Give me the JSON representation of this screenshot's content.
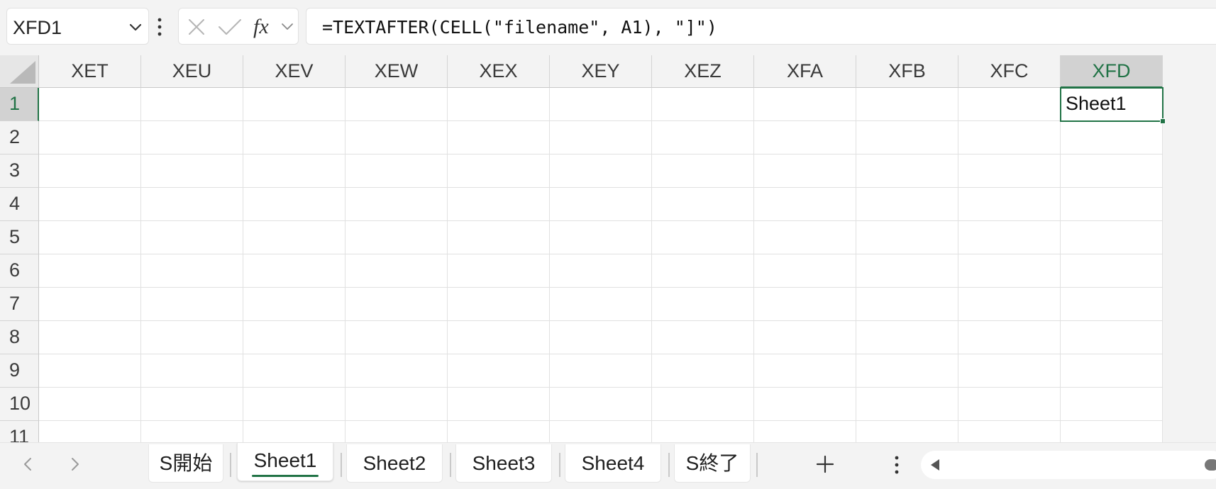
{
  "formula_bar": {
    "name_box_value": "XFD1",
    "formula_text": "=TEXTAFTER(CELL(\"filename\", A1), \"]\")",
    "icons": [
      "chevron-down-icon",
      "more-vertical-icon",
      "cancel-x-icon",
      "confirm-check-icon",
      "function-fx-icon"
    ]
  },
  "grid": {
    "columns": [
      "XET",
      "XEU",
      "XEV",
      "XEW",
      "XEX",
      "XEY",
      "XEZ",
      "XFA",
      "XFB",
      "XFC",
      "XFD"
    ],
    "rows": [
      "1",
      "2",
      "3",
      "4",
      "5",
      "6",
      "7",
      "8",
      "9",
      "10",
      "11"
    ],
    "selected_column": "XFD",
    "selected_row": "1",
    "active_cell": {
      "address": "XFD1",
      "value": "Sheet1"
    }
  },
  "sheet_tabs": {
    "tabs": [
      {
        "label": "S開始",
        "active": false
      },
      {
        "label": "Sheet1",
        "active": true
      },
      {
        "label": "Sheet2",
        "active": false
      },
      {
        "label": "Sheet3",
        "active": false
      },
      {
        "label": "Sheet4",
        "active": false
      },
      {
        "label": "S終了",
        "active": false
      }
    ],
    "icons": [
      "chevron-left-icon",
      "chevron-right-icon",
      "plus-icon",
      "more-vertical-icon",
      "scroll-left-icon"
    ]
  },
  "colors": {
    "accent": "#217346",
    "header_selected": "#d2d2d2",
    "gridline": "#e1e1e1"
  }
}
